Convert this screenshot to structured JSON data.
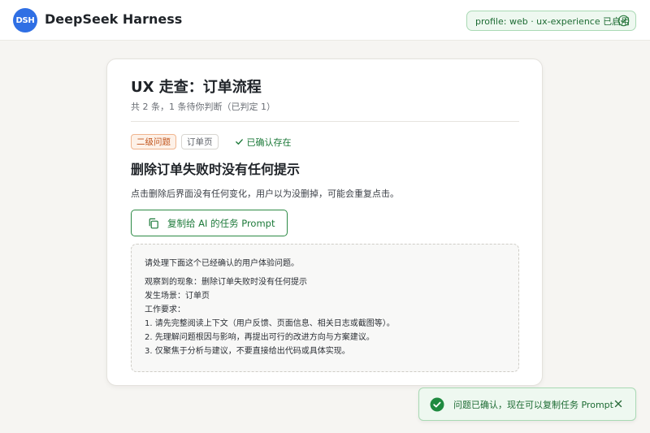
{
  "header": {
    "logo_text": "DSH",
    "brand": "DeepSeek Harness",
    "profile_badge": "profile: web · ux-experience 已启用",
    "badge_icon": "check-circle-icon"
  },
  "card": {
    "title": "UX 走查：订单流程",
    "subtitle": "共 2 条，1 条待你判断（已判定 1）",
    "tags": {
      "severity": "二级问题",
      "page": "订单页",
      "confirmed": "已确认存在"
    },
    "issue_title": "删除订单失败时没有任何提示",
    "issue_desc": "点击删除后界面没有任何变化，用户以为没删掉，可能会重复点击。",
    "copy_button_label": "复制给 AI 的任务 Prompt",
    "prompt": {
      "intro": "请处理下面这个已经确认的用户体验问题。",
      "observed": "观察到的现象：删除订单失败时没有任何提示",
      "scene": "发生场景：订单页",
      "requirements_title": "工作要求：",
      "requirements": [
        "1.  请先完整阅读上下文（用户反馈、页面信息、相关日志或截图等）。",
        "2.  先理解问题根因与影响，再提出可行的改进方向与方案建议。",
        "3.  仅聚焦于分析与建议，不要直接给出代码或具体实现。"
      ]
    }
  },
  "toast": {
    "message": "问题已确认，现在可以复制任务 Prompt",
    "icon": "check-circle-filled-icon"
  },
  "colors": {
    "accent_blue": "#2f6fe4",
    "success_green": "#1d7a3a",
    "warning_orange": "#c2571f"
  }
}
